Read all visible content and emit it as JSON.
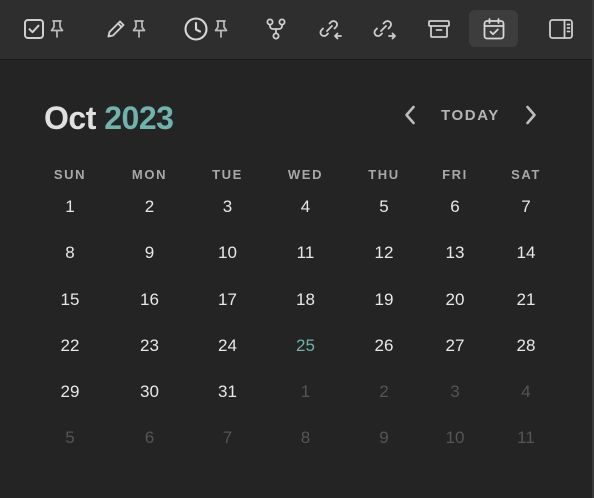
{
  "colors": {
    "background": "#242424",
    "toolbar": "#2e2e2e",
    "accent": "#6fb3ad",
    "text": "#e8e8e8",
    "muted": "#555555"
  },
  "toolbar": {
    "items": [
      {
        "icon": "checkbox-icon",
        "pinned": true
      },
      {
        "icon": "pencil-icon",
        "pinned": true
      },
      {
        "icon": "clock-icon",
        "pinned": true
      },
      {
        "icon": "git-fork-icon",
        "pinned": false
      },
      {
        "icon": "incoming-link-icon",
        "pinned": false
      },
      {
        "icon": "outgoing-link-icon",
        "pinned": false
      },
      {
        "icon": "archive-icon",
        "pinned": false
      },
      {
        "icon": "calendar-check-icon",
        "pinned": false,
        "active": true
      },
      {
        "icon": "right-sidebar-icon",
        "pinned": false
      }
    ]
  },
  "calendar": {
    "month": "Oct",
    "year": "2023",
    "today_label": "TODAY",
    "weekdays": [
      "SUN",
      "MON",
      "TUE",
      "WED",
      "THU",
      "FRI",
      "SAT"
    ],
    "weeks": [
      [
        {
          "d": "1"
        },
        {
          "d": "2"
        },
        {
          "d": "3"
        },
        {
          "d": "4"
        },
        {
          "d": "5"
        },
        {
          "d": "6"
        },
        {
          "d": "7"
        }
      ],
      [
        {
          "d": "8"
        },
        {
          "d": "9"
        },
        {
          "d": "10"
        },
        {
          "d": "11"
        },
        {
          "d": "12"
        },
        {
          "d": "13"
        },
        {
          "d": "14"
        }
      ],
      [
        {
          "d": "15"
        },
        {
          "d": "16"
        },
        {
          "d": "17"
        },
        {
          "d": "18"
        },
        {
          "d": "19"
        },
        {
          "d": "20"
        },
        {
          "d": "21"
        }
      ],
      [
        {
          "d": "22"
        },
        {
          "d": "23"
        },
        {
          "d": "24"
        },
        {
          "d": "25",
          "today": true
        },
        {
          "d": "26"
        },
        {
          "d": "27"
        },
        {
          "d": "28"
        }
      ],
      [
        {
          "d": "29"
        },
        {
          "d": "30"
        },
        {
          "d": "31"
        },
        {
          "d": "1",
          "other": true
        },
        {
          "d": "2",
          "other": true
        },
        {
          "d": "3",
          "other": true
        },
        {
          "d": "4",
          "other": true
        }
      ],
      [
        {
          "d": "5",
          "other": true
        },
        {
          "d": "6",
          "other": true
        },
        {
          "d": "7",
          "other": true
        },
        {
          "d": "8",
          "other": true
        },
        {
          "d": "9",
          "other": true
        },
        {
          "d": "10",
          "other": true
        },
        {
          "d": "11",
          "other": true
        }
      ]
    ]
  }
}
